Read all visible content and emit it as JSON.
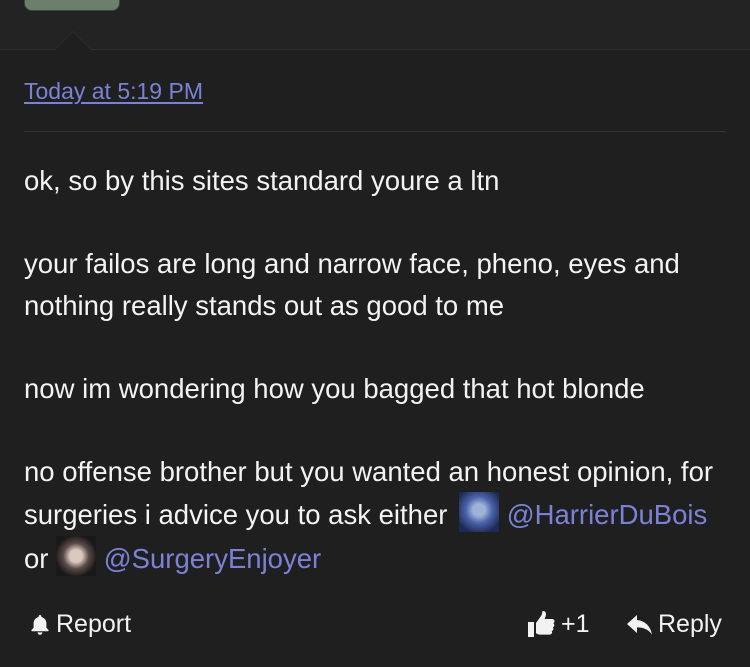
{
  "comment": {
    "timestamp": "Today at 5:19 PM",
    "paragraphs": {
      "p1": "ok, so by this sites standard youre a ltn",
      "p2": "your failos are long and narrow face, pheno, eyes and nothing really stands out as good to me",
      "p3": "now im wondering how you bagged that hot blonde",
      "p4_text": "no offense brother but you wanted an honest opinion, for surgeries i advice you to ask either ",
      "mention1": "@HarrierDuBois",
      "or": " or ",
      "mention2": "@SurgeryEnjoyer"
    }
  },
  "footer": {
    "report_label": "Report",
    "like_count": "+1",
    "reply_label": "Reply"
  },
  "colors": {
    "background": "#1f1f20",
    "link": "#7b82d6",
    "text": "#f3f3f3"
  }
}
